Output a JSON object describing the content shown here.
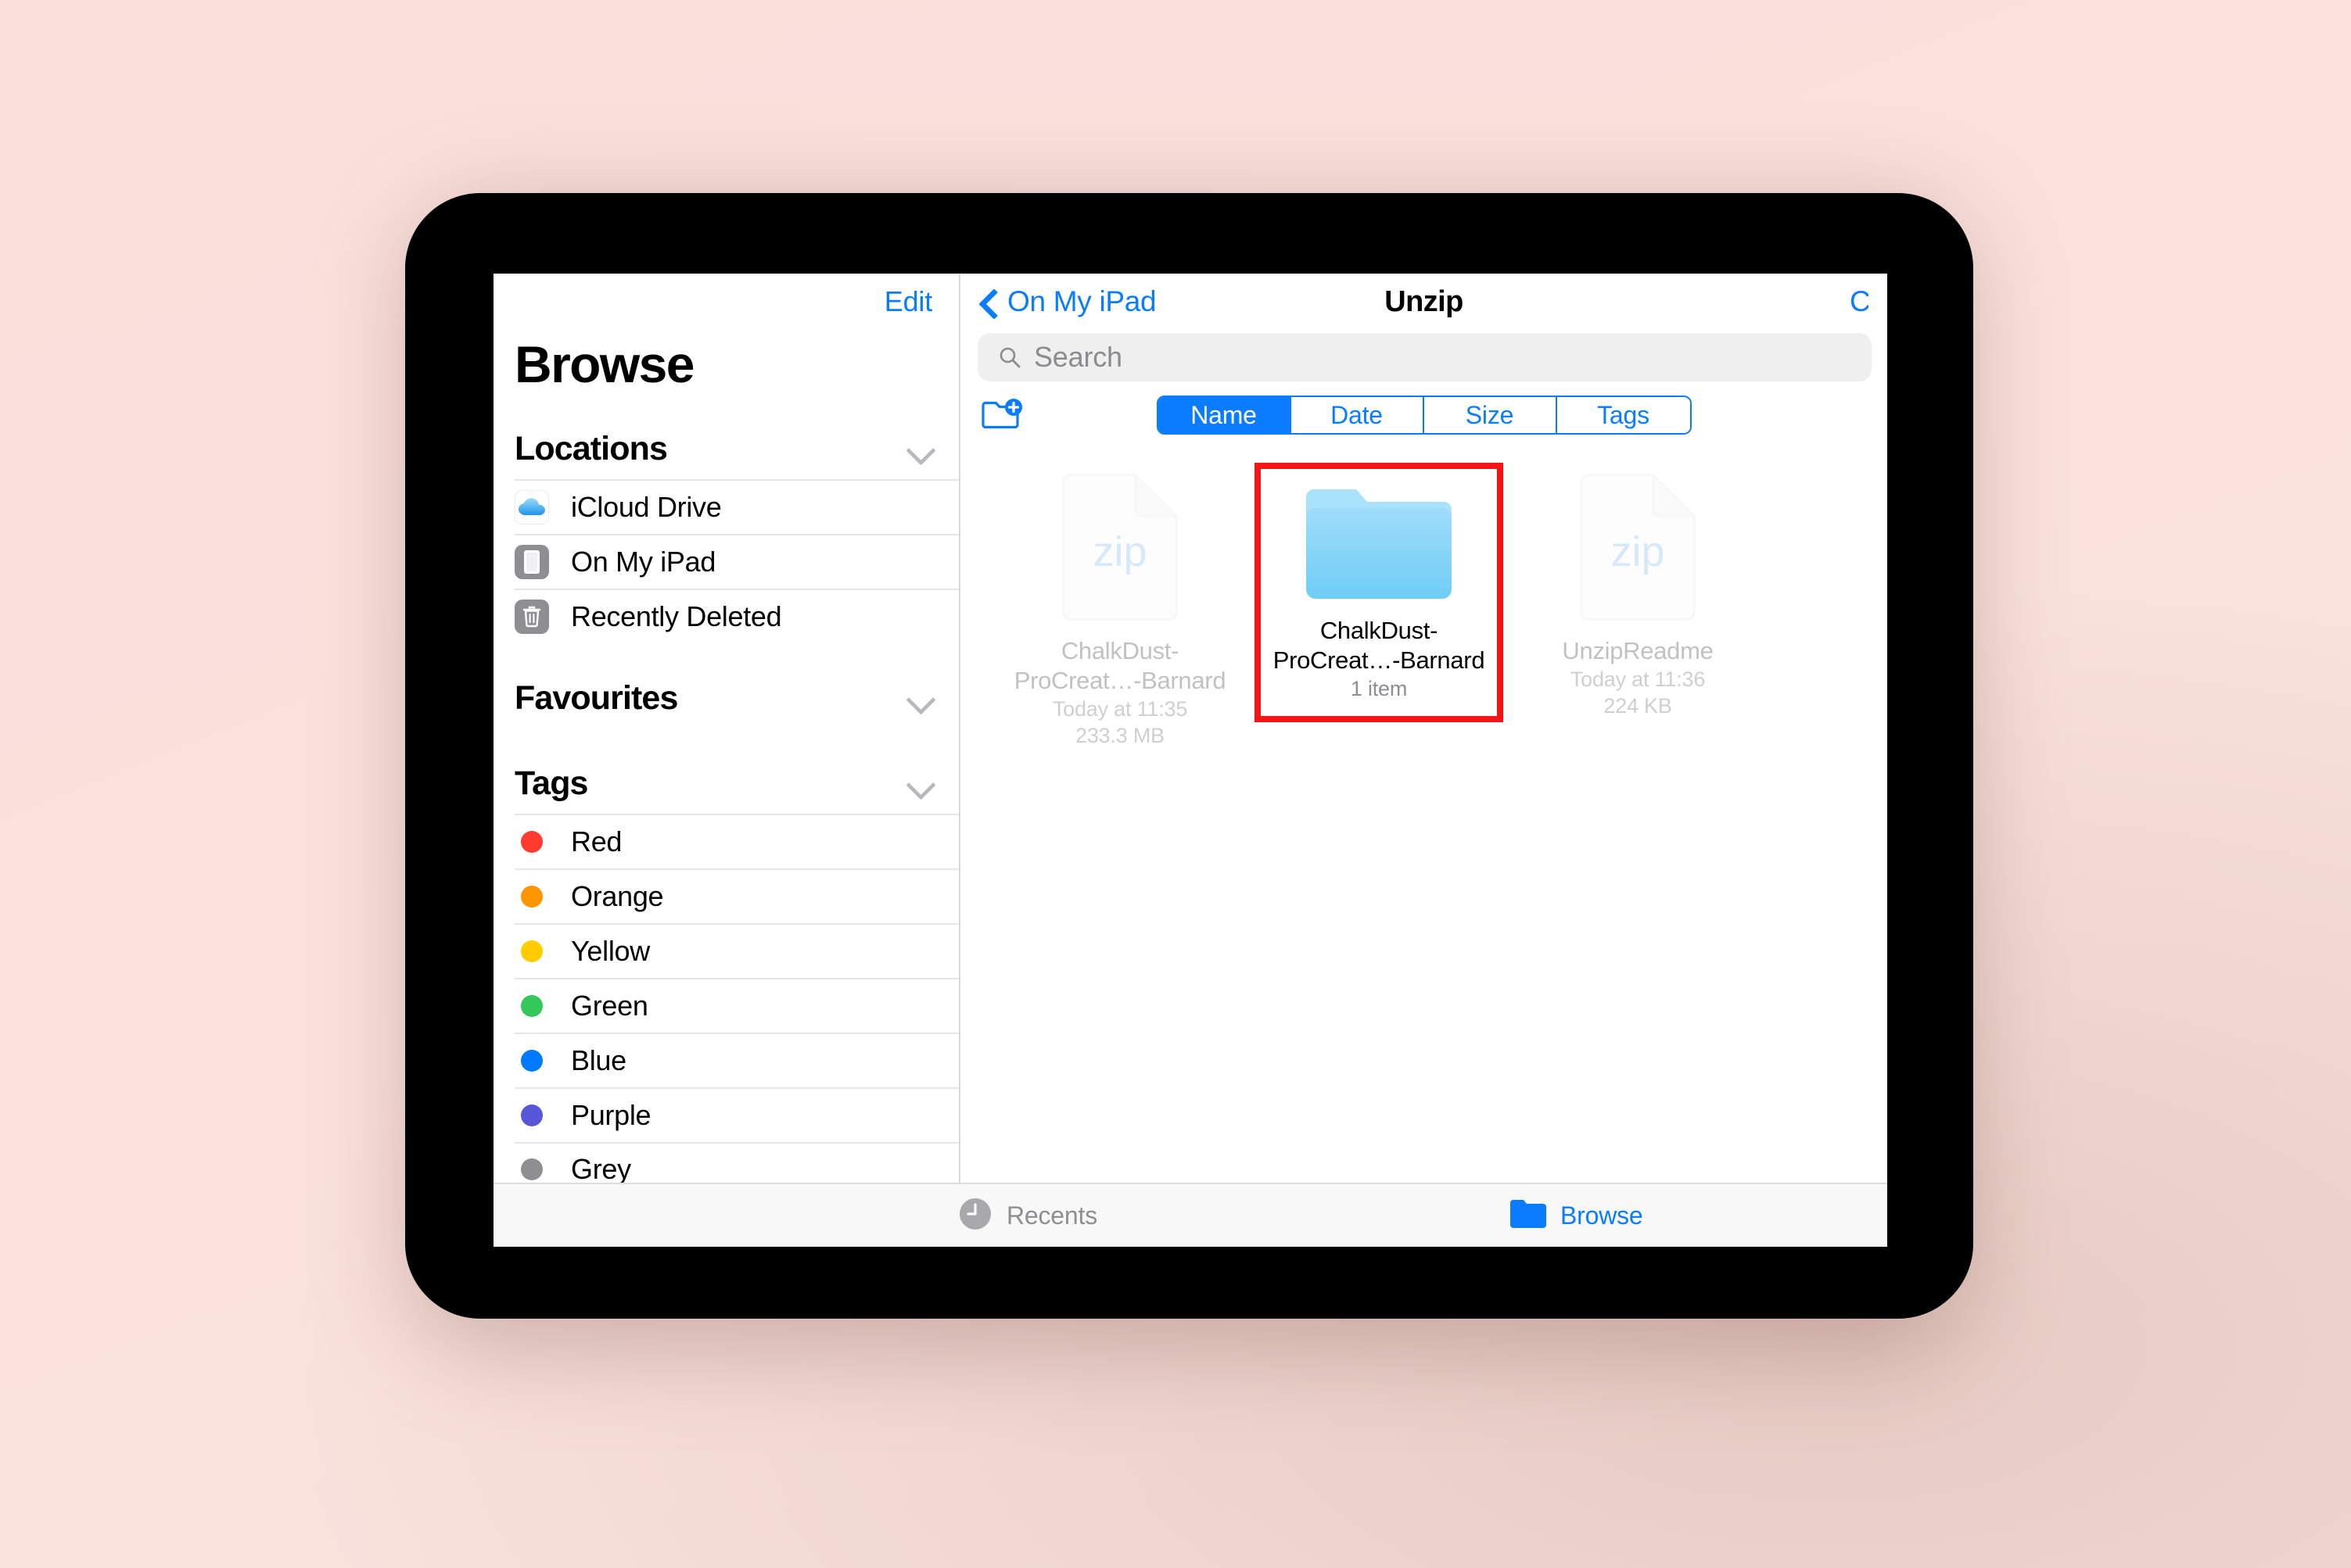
{
  "app": {
    "name": "Files",
    "accent_color": "#0a7cff",
    "highlight_color": "#f41616"
  },
  "sidebar": {
    "edit_label": "Edit",
    "title": "Browse",
    "sections": [
      {
        "title": "Locations",
        "items": [
          {
            "label": "iCloud Drive",
            "icon": "icloud-icon"
          },
          {
            "label": "On My iPad",
            "icon": "ipad-icon"
          },
          {
            "label": "Recently Deleted",
            "icon": "trash-icon"
          }
        ]
      },
      {
        "title": "Favourites",
        "items": []
      },
      {
        "title": "Tags",
        "items": [
          {
            "label": "Red",
            "color": "#ff3b30"
          },
          {
            "label": "Orange",
            "color": "#ff9500"
          },
          {
            "label": "Yellow",
            "color": "#ffcc00"
          },
          {
            "label": "Green",
            "color": "#34c759"
          },
          {
            "label": "Blue",
            "color": "#007aff"
          },
          {
            "label": "Purple",
            "color": "#5756d6"
          },
          {
            "label": "Grey",
            "color": "#8e8e93"
          }
        ]
      }
    ]
  },
  "navbar": {
    "back_label": "On My iPad",
    "title": "Unzip",
    "right_label": "C"
  },
  "search": {
    "placeholder": "Search",
    "value": ""
  },
  "toolbar": {
    "new_folder_icon": "new-folder-icon",
    "segments": [
      {
        "label": "Name",
        "selected": true
      },
      {
        "label": "Date",
        "selected": false
      },
      {
        "label": "Size",
        "selected": false
      },
      {
        "label": "Tags",
        "selected": false
      }
    ]
  },
  "files": [
    {
      "name": "ChalkDust-ProCreat…-Barnard",
      "line1": "Today at 11:35",
      "line2": "233.3 MB",
      "kind": "zip",
      "badge": "zip",
      "faded": true,
      "selected": false
    },
    {
      "name": "ChalkDust-ProCreat…-Barnard",
      "line1": "1 item",
      "line2": "",
      "kind": "folder",
      "badge": "",
      "faded": false,
      "selected": true
    },
    {
      "name": "UnzipReadme",
      "line1": "Today at 11:36",
      "line2": "224 KB",
      "kind": "zip",
      "badge": "zip",
      "faded": true,
      "selected": false
    }
  ],
  "tabbar": {
    "tabs": [
      {
        "label": "Recents",
        "icon": "clock-icon",
        "active": false
      },
      {
        "label": "Browse",
        "icon": "folder-icon",
        "active": true
      }
    ]
  }
}
